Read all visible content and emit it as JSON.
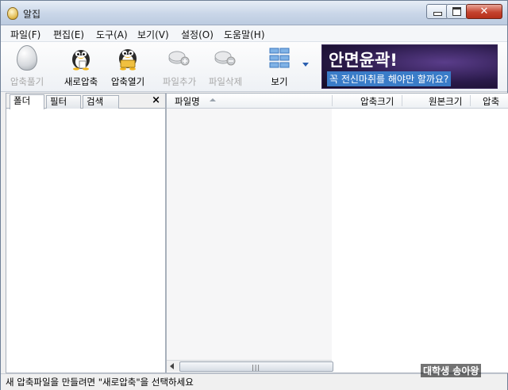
{
  "window": {
    "title": "알집"
  },
  "menu": [
    "파일(F)",
    "편집(E)",
    "도구(A)",
    "보기(V)",
    "설정(O)",
    "도움말(H)"
  ],
  "toolbar": {
    "extract": "압축풀기",
    "new_archive": "새로압축",
    "open_archive": "압축열기",
    "add_file": "파일추가",
    "delete_file": "파일삭제",
    "view": "보기"
  },
  "banner": {
    "line1": "안면윤곽!",
    "line2": "꼭 전신마취를 해야만 할까요?"
  },
  "left_tabs": [
    "폴더",
    "필터",
    "검색"
  ],
  "left_close": "×",
  "columns": [
    "파일명",
    "압축크기",
    "원본크기",
    "압축"
  ],
  "scroll_grip": "|||",
  "status": "새 압축파일을 만들려면 \"새로압축\"을 선택하세요",
  "watermark": "대학생 송아왕",
  "colors": {
    "disabled_text": "#a8a8a8",
    "accent": "#2a5fb0",
    "close_red": "#c5442f"
  }
}
